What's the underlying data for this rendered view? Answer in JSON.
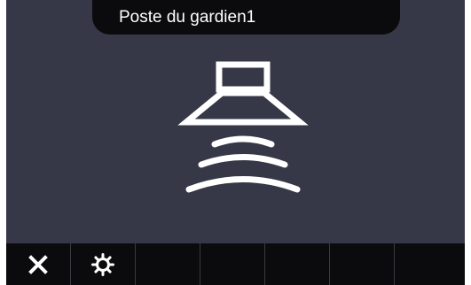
{
  "header": {
    "title": "Poste du gardien1"
  },
  "main": {
    "status_icon": "speaker-sound-waves-icon"
  },
  "toolbar": {
    "buttons": [
      {
        "icon": "close-icon"
      },
      {
        "icon": "settings-icon"
      },
      {
        "icon": ""
      },
      {
        "icon": ""
      },
      {
        "icon": ""
      },
      {
        "icon": ""
      },
      {
        "icon": ""
      }
    ]
  },
  "colors": {
    "screen_background": "#363747",
    "bar_background": "#0b0b0d",
    "foreground": "#ffffff"
  }
}
